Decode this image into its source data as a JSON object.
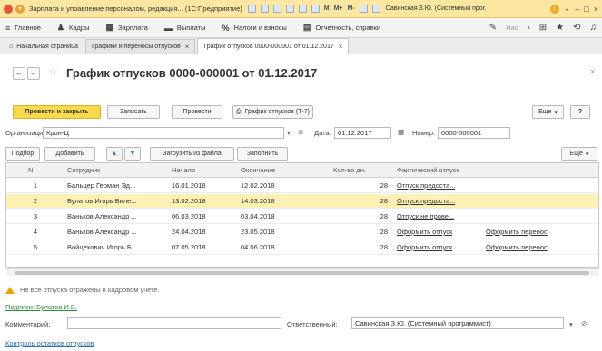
{
  "window": {
    "title": "Зарплата и управление персоналом, редакция... (1С:Предприятие)",
    "tools": [
      "M",
      "M+",
      "M-"
    ],
    "user": "Савинская З.Ю. (Системный прог..."
  },
  "menu": {
    "items": [
      {
        "icon": "≡",
        "label": "Главное"
      },
      {
        "icon": "♟",
        "label": "Кадры"
      },
      {
        "icon": "▦",
        "label": "Зарплата"
      },
      {
        "icon": "▬",
        "label": "Выплаты"
      },
      {
        "icon": "%",
        "label": "Налоги и взносы"
      },
      {
        "icon": "▤",
        "label": "Отчетность, справки"
      }
    ],
    "search": "Нас"
  },
  "tabs": {
    "home": "Начальная страница",
    "items": [
      "Графики и переносы отпусков",
      "График отпусков 0000-000001 от 01.12.2017"
    ]
  },
  "document": {
    "title": "График отпусков 0000-000001 от 01.12.2017"
  },
  "toolbar": {
    "post_close": "Провести и закрыть",
    "save": "Записать",
    "post": "Провести",
    "print": "График отпусков (Т-7)",
    "more": "Еще",
    "help": "?"
  },
  "header": {
    "org_label": "Организация:",
    "org_value": "Крон-Ц",
    "date_label": "Дата:",
    "date_value": "01.12.2017",
    "number_label": "Номер:",
    "number_value": "0000-000001"
  },
  "table_toolbar": {
    "select": "Подбор",
    "add": "Добавить",
    "load": "Загрузить из файла",
    "fill": "Заполнить",
    "more": "Еще"
  },
  "table": {
    "columns": [
      "N",
      "Сотрудник",
      "Начало",
      "Окончание",
      "Кол-во дн.",
      "Фактический отпуск"
    ],
    "rows": [
      {
        "n": "1",
        "employee": "Бальцер Герман Эд...",
        "start": "16.01.2018",
        "end": "12.02.2018",
        "days": "28",
        "actual": "Отпуск предоста...",
        "transfer": ""
      },
      {
        "n": "2",
        "employee": "Булатов Игорь Виле...",
        "start": "13.02.2018",
        "end": "14.03.2018",
        "days": "28",
        "actual": "Отпуск предоста...",
        "transfer": ""
      },
      {
        "n": "3",
        "employee": "Ваньков Александр ...",
        "start": "06.03.2018",
        "end": "03.04.2018",
        "days": "28",
        "actual": "Отпуск не прове...",
        "transfer": ""
      },
      {
        "n": "4",
        "employee": "Ваньков Александр ...",
        "start": "24.04.2018",
        "end": "23.05.2018",
        "days": "28",
        "actual": "Оформить отпуск",
        "transfer": "Оформить перенос"
      },
      {
        "n": "5",
        "employee": "Войцехович Игорь Б...",
        "start": "07.05.2018",
        "end": "04.06.2018",
        "days": "28",
        "actual": "Оформить отпуск",
        "transfer": "Оформить перенос"
      }
    ],
    "selected_row": 1
  },
  "footer": {
    "warning": "Не все отпуска отражены в кадровом учете.",
    "signatures": "Подписи: Булатов И.В.",
    "comment_label": "Комментарий:",
    "responsible_label": "Ответственный:",
    "responsible_value": "Савинская З.Ю. (Системный программист)",
    "control_link": "Контроль остатков отпусков"
  },
  "colors": {
    "primary_button": "#fad94c",
    "selected_row": "#fcf0b5",
    "title_bar": "#fbe7a1",
    "link_green": "#2f8a40"
  }
}
